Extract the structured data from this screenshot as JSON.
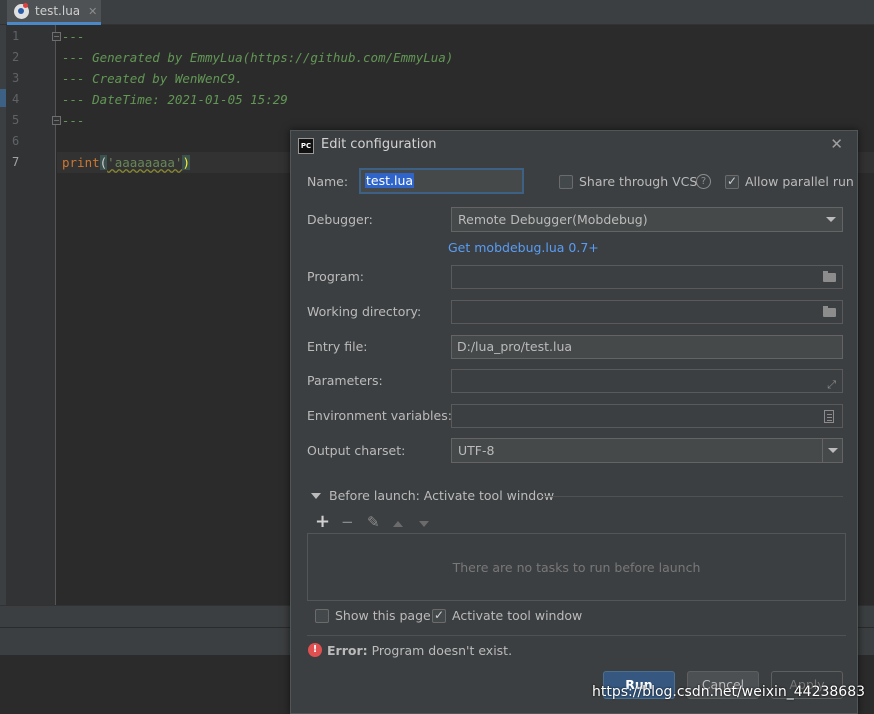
{
  "tab": {
    "filename": "test.lua",
    "close_glyph": "✕"
  },
  "editor": {
    "line_numbers": [
      "1",
      "2",
      "3",
      "4",
      "5",
      "6",
      "7"
    ],
    "lines": [
      "---",
      "--- Generated by EmmyLua(https://github.com/EmmyLua)",
      "--- Created by WenWenC9.",
      "--- DateTime: 2021-01-05 15:29",
      "---",
      "",
      ""
    ],
    "line7": {
      "keyword": "print",
      "open_paren": "(",
      "string": "'aaaaaaaa'",
      "close_paren": ")"
    }
  },
  "dialog": {
    "icon_text": "PC",
    "title": "Edit configuration",
    "close_glyph": "✕",
    "name_label": "Name:",
    "name_value": "test.lua",
    "share_vcs_label": "Share through VCS",
    "share_vcs_checked": false,
    "help_glyph": "?",
    "allow_parallel_label": "Allow parallel run",
    "allow_parallel_checked": true,
    "debugger_label": "Debugger:",
    "debugger_value": "Remote Debugger(Mobdebug)",
    "debugger_link": "Get mobdebug.lua 0.7+",
    "program_label": "Program:",
    "program_value": "",
    "working_dir_label": "Working directory:",
    "working_dir_value": "",
    "entry_file_label": "Entry file:",
    "entry_file_value": "D:/lua_pro/test.lua",
    "parameters_label": "Parameters:",
    "parameters_value": "",
    "env_label": "Environment variables:",
    "env_value": "",
    "charset_label": "Output charset:",
    "charset_value": "UTF-8",
    "before_launch_label": "Before launch: Activate tool window",
    "toolbar": {
      "add": "+",
      "remove": "−",
      "edit": "✎"
    },
    "no_tasks_text": "There are no tasks to run before launch",
    "show_page_label": "Show this page",
    "show_page_checked": false,
    "activate_tool_label": "Activate tool window",
    "activate_tool_checked": true,
    "error_icon_glyph": "!",
    "error_prefix": "Error:",
    "error_message": " Program doesn't exist.",
    "run_button": "Run",
    "cancel_button": "Cancel",
    "apply_button": "Apply"
  },
  "watermark": "https://blog.csdn.net/weixin_44238683",
  "colors": {
    "accent": "#4a88c7",
    "link": "#589df6",
    "primary_button": "#365880",
    "error": "#e05050",
    "comment": "#629755",
    "keyword": "#cc7832",
    "string": "#6a8759"
  }
}
